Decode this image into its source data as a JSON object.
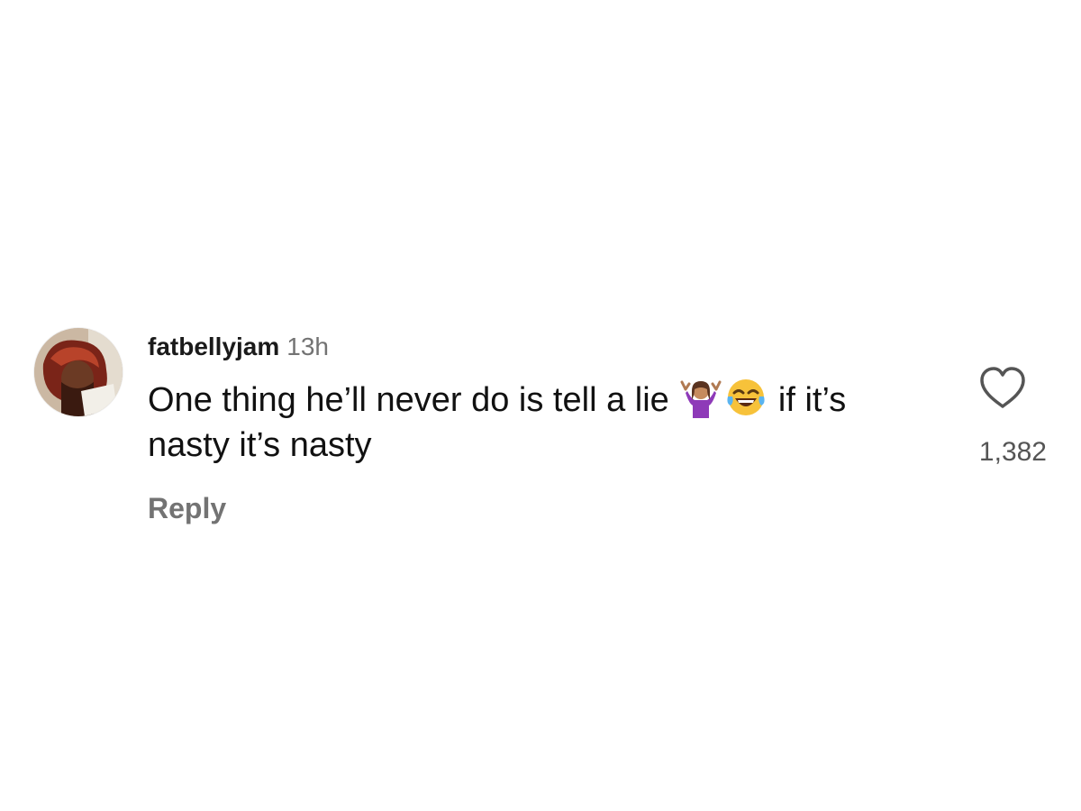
{
  "comment": {
    "username": "fatbellyjam",
    "timestamp": "13h",
    "text_part1": "One thing he’ll never do is tell a lie",
    "emoji_1": "woman-shrugging-emoji",
    "emoji_2": "face-with-tears-of-joy-emoji",
    "text_part2": "if it’s nasty it’s nasty",
    "reply_label": "Reply",
    "like_count": "1,382",
    "like_icon": "heart-outline-icon"
  },
  "colors": {
    "text": "#111111",
    "secondary": "#737373",
    "background": "#ffffff"
  }
}
